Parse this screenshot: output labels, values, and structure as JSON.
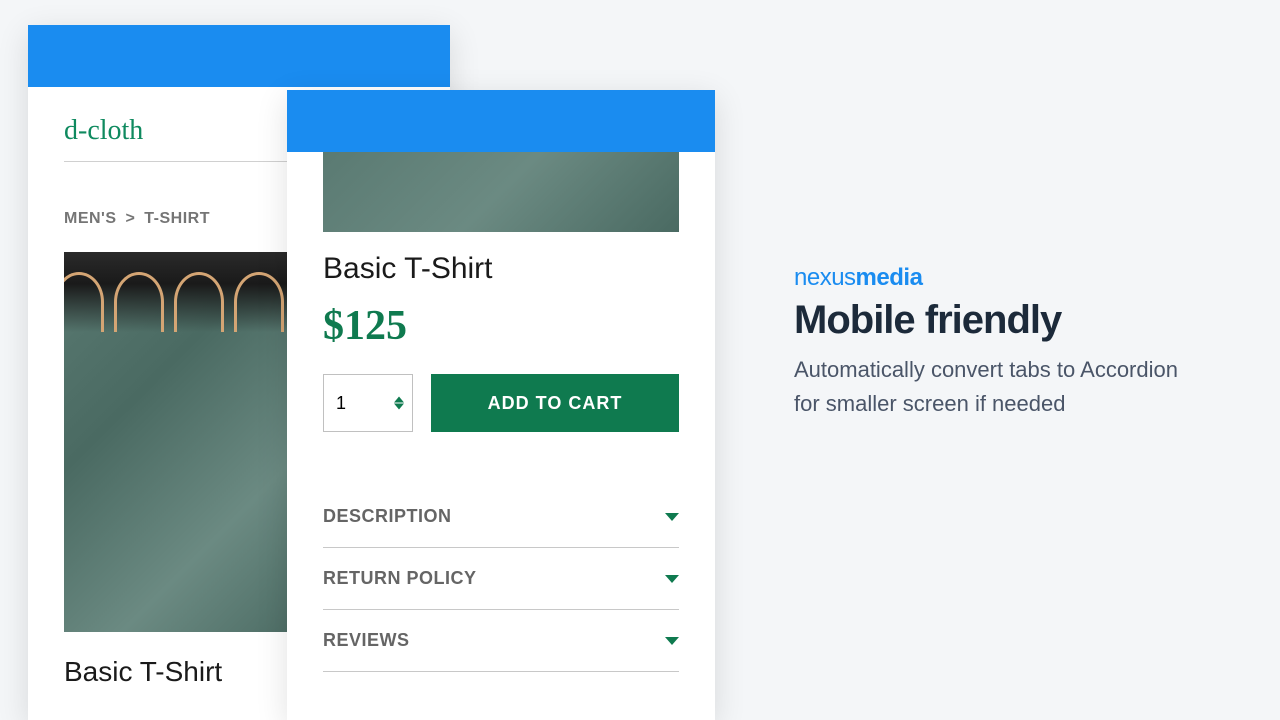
{
  "back_phone": {
    "logo": "d-cloth",
    "breadcrumb": {
      "cat": "MEN'S",
      "sep": ">",
      "sub": "T-SHIRT"
    },
    "product_title": "Basic T-Shirt"
  },
  "front_phone": {
    "product_title": "Basic T-Shirt",
    "price": "$125",
    "qty": "1",
    "add_to_cart": "ADD TO CART",
    "accordion": [
      {
        "label": "DESCRIPTION"
      },
      {
        "label": "RETURN POLICY"
      },
      {
        "label": "REVIEWS"
      }
    ]
  },
  "marketing": {
    "brand_light": "nexus",
    "brand_bold": "media",
    "headline": "Mobile friendly",
    "subcopy": "Automatically convert tabs to Accordion for smaller screen if needed"
  }
}
